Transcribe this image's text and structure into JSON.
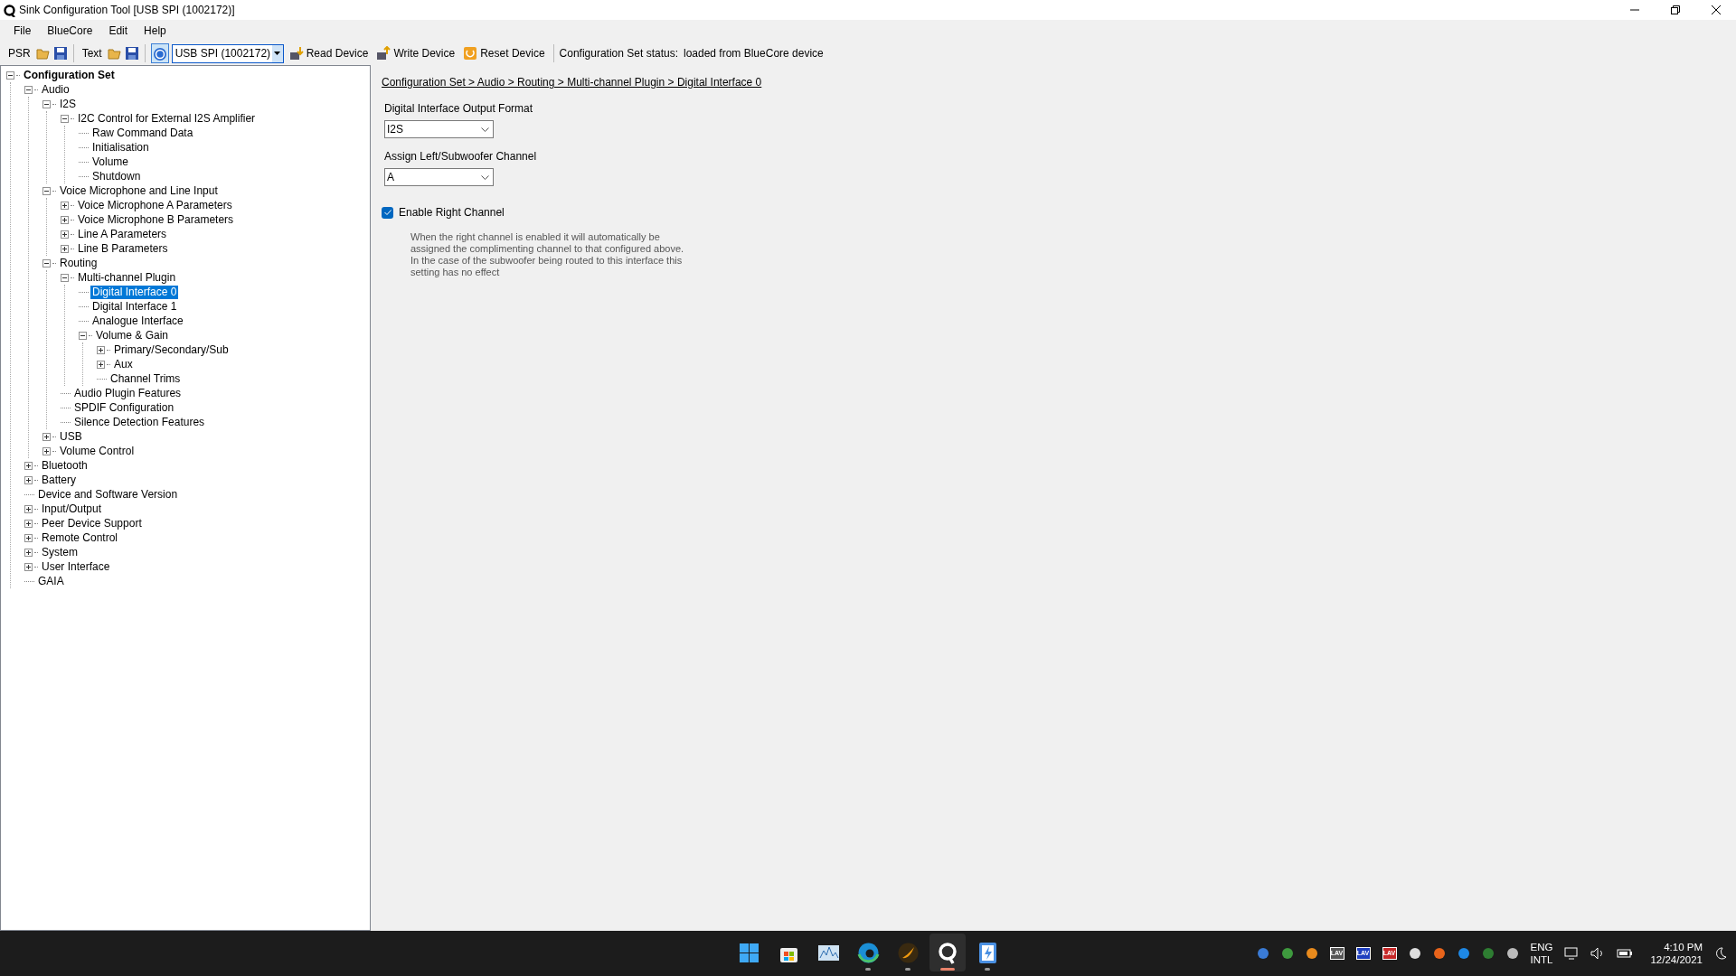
{
  "window": {
    "title": "Sink Configuration Tool [USB SPI (1002172)]"
  },
  "menu": [
    "File",
    "BlueCore",
    "Edit",
    "Help"
  ],
  "toolbar": [
    {
      "kind": "text",
      "label": "PSR"
    },
    {
      "kind": "open"
    },
    {
      "kind": "save"
    },
    {
      "kind": "sep"
    },
    {
      "kind": "text",
      "label": "Text"
    },
    {
      "kind": "open"
    },
    {
      "kind": "save"
    },
    {
      "kind": "sep"
    },
    {
      "kind": "help",
      "selected": true
    },
    {
      "kind": "combo",
      "value": "USB SPI (1002172)"
    },
    {
      "kind": "read",
      "label": "Read Device"
    },
    {
      "kind": "write",
      "label": "Write Device"
    },
    {
      "kind": "reset",
      "label": "Reset Device"
    },
    {
      "kind": "sep"
    },
    {
      "kind": "status",
      "label": "Configuration Set status:",
      "value": "loaded from BlueCore device"
    }
  ],
  "tree": [
    {
      "label": "Configuration Set",
      "expanded": true,
      "selected": false,
      "children": [
        {
          "label": "Audio",
          "expanded": true,
          "selected": false,
          "children": [
            {
              "label": "I2S",
              "expanded": true,
              "selected": false,
              "children": [
                {
                  "label": "I2C Control for External I2S Amplifier",
                  "expanded": true,
                  "selected": false,
                  "children": [
                    {
                      "label": "Raw Command Data",
                      "selected": false
                    },
                    {
                      "label": "Initialisation",
                      "selected": false
                    },
                    {
                      "label": "Volume",
                      "selected": false
                    },
                    {
                      "label": "Shutdown",
                      "selected": false
                    }
                  ]
                }
              ]
            },
            {
              "label": "Voice Microphone and Line Input",
              "expanded": true,
              "selected": false,
              "children": [
                {
                  "label": "Voice Microphone A Parameters",
                  "expanded": false,
                  "selected": false
                },
                {
                  "label": "Voice Microphone B Parameters",
                  "expanded": false,
                  "selected": false
                },
                {
                  "label": "Line A Parameters",
                  "expanded": false,
                  "selected": false
                },
                {
                  "label": "Line B Parameters",
                  "expanded": false,
                  "selected": false
                }
              ]
            },
            {
              "label": "Routing",
              "expanded": true,
              "selected": false,
              "children": [
                {
                  "label": "Multi-channel Plugin",
                  "expanded": true,
                  "selected": false,
                  "children": [
                    {
                      "label": "Digital Interface 0",
                      "selected": true
                    },
                    {
                      "label": "Digital Interface 1",
                      "selected": false
                    },
                    {
                      "label": "Analogue Interface",
                      "selected": false
                    },
                    {
                      "label": "Volume & Gain",
                      "expanded": true,
                      "selected": false,
                      "children": [
                        {
                          "label": "Primary/Secondary/Sub",
                          "expanded": false,
                          "selected": false
                        },
                        {
                          "label": "Aux",
                          "expanded": false,
                          "selected": false
                        },
                        {
                          "label": "Channel Trims",
                          "selected": false
                        }
                      ]
                    }
                  ]
                },
                {
                  "label": "Audio Plugin Features",
                  "selected": false
                },
                {
                  "label": "SPDIF Configuration",
                  "selected": false
                },
                {
                  "label": "Silence Detection Features",
                  "selected": false
                }
              ]
            },
            {
              "label": "USB",
              "expanded": false,
              "selected": false
            },
            {
              "label": "Volume Control",
              "expanded": false,
              "selected": false
            }
          ]
        },
        {
          "label": "Bluetooth",
          "expanded": false,
          "selected": false
        },
        {
          "label": "Battery",
          "expanded": false,
          "selected": false
        },
        {
          "label": "Device and Software Version",
          "selected": false
        },
        {
          "label": "Input/Output",
          "expanded": false,
          "selected": false
        },
        {
          "label": "Peer Device Support",
          "expanded": false,
          "selected": false
        },
        {
          "label": "Remote Control",
          "expanded": false,
          "selected": false
        },
        {
          "label": "System",
          "expanded": false,
          "selected": false
        },
        {
          "label": "User Interface",
          "expanded": false,
          "selected": false
        },
        {
          "label": "GAIA",
          "selected": false
        }
      ]
    }
  ],
  "panel": {
    "breadcrumb": "Configuration Set > Audio > Routing > Multi-channel Plugin > Digital Interface 0",
    "fields": [
      {
        "label": "Digital Interface Output Format",
        "value": "I2S"
      },
      {
        "label": "Assign Left/Subwoofer Channel",
        "value": "A"
      }
    ],
    "checkbox": {
      "label": "Enable Right Channel",
      "checked": true
    },
    "help": "When the right channel is enabled it will automatically be assigned the complimenting channel to that configured above. In the case of the subwoofer being routed to this interface this setting has no effect"
  },
  "taskbar": {
    "apps": [
      {
        "kind": "start",
        "running": false,
        "selected": false
      },
      {
        "kind": "store",
        "running": false,
        "selected": false
      },
      {
        "kind": "monitor",
        "running": false,
        "selected": false
      },
      {
        "kind": "browser",
        "running": true,
        "selected": false
      },
      {
        "kind": "flame",
        "running": true,
        "selected": false
      },
      {
        "kind": "q",
        "running": true,
        "selected": true
      },
      {
        "kind": "flash",
        "running": true,
        "selected": false
      }
    ],
    "tray": [
      {
        "kind": "icon",
        "color": "#3a7bd5"
      },
      {
        "kind": "icon",
        "color": "#3e9a3e"
      },
      {
        "kind": "icon",
        "color": "#e98b1d"
      },
      {
        "kind": "badge",
        "label": "LAV",
        "color": "#555555"
      },
      {
        "kind": "badge",
        "label": "LAV",
        "color": "#1f3fbf"
      },
      {
        "kind": "badge",
        "label": "LAV",
        "color": "#c62828"
      },
      {
        "kind": "icon",
        "color": "#dddddd"
      },
      {
        "kind": "icon",
        "color": "#e8641b"
      },
      {
        "kind": "icon",
        "color": "#1e88e5"
      },
      {
        "kind": "icon",
        "color": "#2e7d32"
      },
      {
        "kind": "icon",
        "color": "#bbbbbb"
      }
    ],
    "language": [
      "ENG",
      "INTL"
    ],
    "time": "4:10 PM",
    "date": "12/24/2021"
  }
}
